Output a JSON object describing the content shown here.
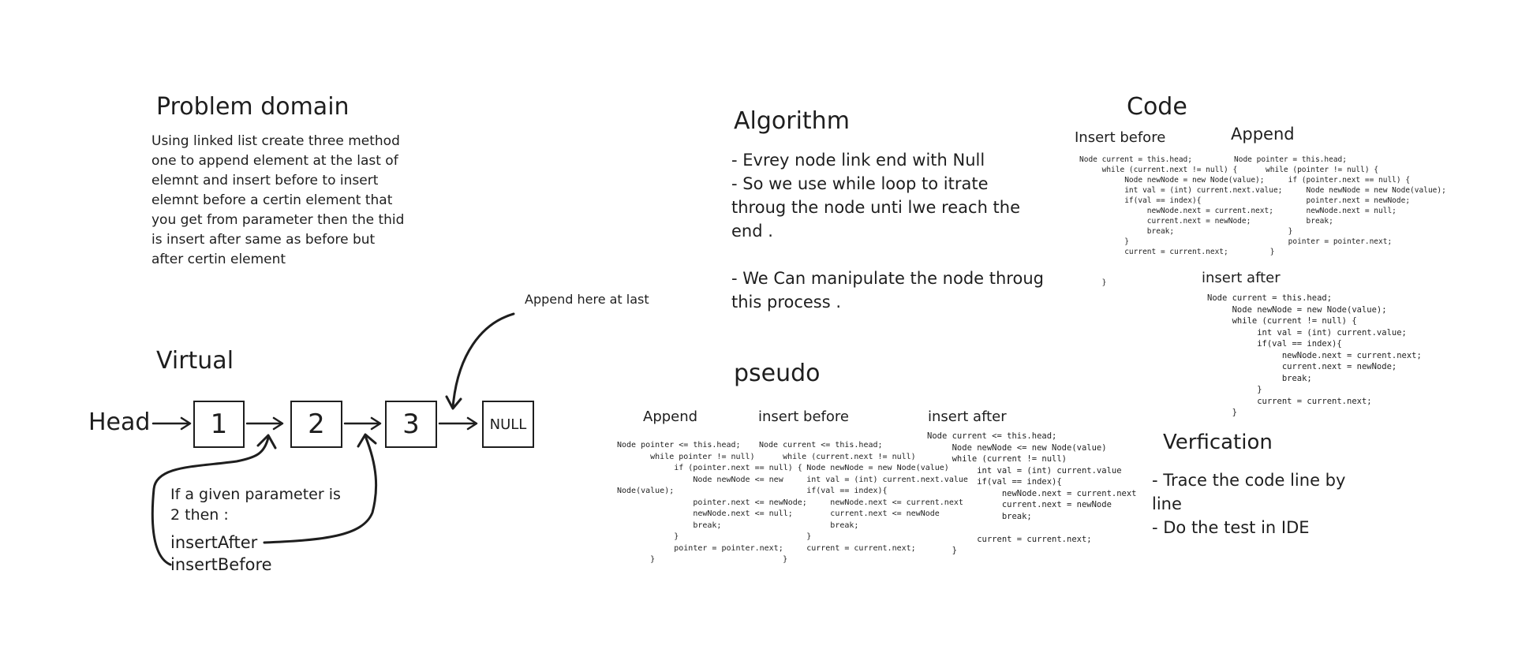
{
  "problem": {
    "title": "Problem domain",
    "lines": [
      "Using linked list create three method",
      "one to append element at the last of",
      "elemnt and insert before to insert",
      "elemnt before a certin element that",
      "you get from parameter then the thid",
      "is insert after same as before but",
      "after certin element"
    ]
  },
  "algorithm": {
    "title": "Algorithm",
    "lines": [
      "- Evrey node link end with Null",
      "- So we use while loop to itrate",
      "throug the node unti lwe reach the",
      "end  .",
      "",
      "- We Can manipulate the node throug",
      "this process ."
    ]
  },
  "code": {
    "title": "Code",
    "insert_before": {
      "label": "Insert before",
      "code": "Node current = this.head;\n     while (current.next != null) {\n          Node newNode = new Node(value);\n          int val = (int) current.next.value;\n          if(val == index){\n               newNode.next = current.next;\n               current.next = newNode;\n               break;\n          }\n          current = current.next;\n\n\n     }"
    },
    "append": {
      "label": "Append",
      "code": "Node pointer = this.head;\n       while (pointer != null) {\n            if (pointer.next == null) {\n                Node newNode = new Node(value);\n                pointer.next = newNode;\n                newNode.next = null;\n                break;\n            }\n            pointer = pointer.next;\n        }"
    },
    "insert_after": {
      "label": "insert after",
      "code": "Node current = this.head;\n     Node newNode = new Node(value);\n     while (current != null) {\n          int val = (int) current.value;\n          if(val == index){\n               newNode.next = current.next;\n               current.next = newNode;\n               break;\n          }\n          current = current.next;\n     }"
    }
  },
  "virtual": {
    "title": "Virtual",
    "head_label": "Head",
    "nodes": [
      "1",
      "2",
      "3"
    ],
    "null_label": "NULL",
    "append_note": "Append here at last",
    "param_note": [
      "If a given parameter is",
      "2 then :"
    ],
    "method_after": "insertAfter",
    "method_before": "insertBefore"
  },
  "pseudo": {
    "title": "pseudo",
    "append": {
      "label": "Append",
      "code": "Node pointer <= this.head;\n       while pointer != null)\n            if (pointer.next == null) {\n                Node newNode <= new\nNode(value);\n                pointer.next <= newNode;\n                newNode.next <= null;\n                break;\n            }\n            pointer = pointer.next;\n       }"
    },
    "insert_before": {
      "label": "insert before",
      "code": "Node current <= this.head;\n     while (current.next != null)\n          Node newNode = new Node(value)\n          int val = (int) current.next.value\n          if(val == index){\n               newNode.next <= current.next\n               current.next <= newNode\n               break;\n          }\n          current = current.next;\n     }"
    },
    "insert_after": {
      "label": "insert after",
      "code": "Node current <= this.head;\n     Node newNode <= new Node(value)\n     while (current != null)\n          int val = (int) current.value\n          if(val == index){\n               newNode.next = current.next\n               current.next = newNode\n               break;\n\n          current = current.next;\n     }"
    }
  },
  "verification": {
    "title": "Verfication",
    "lines": [
      "- Trace the code line by",
      "line",
      "- Do the test in IDE"
    ]
  }
}
